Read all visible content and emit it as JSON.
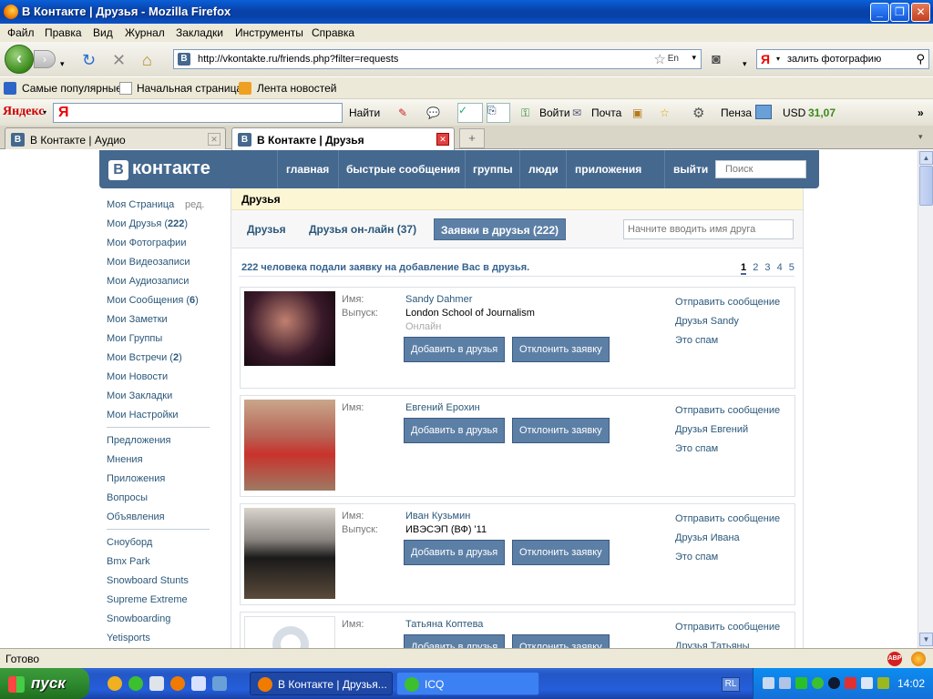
{
  "window": {
    "title": "В Контакте | Друзья - Mozilla Firefox"
  },
  "menubar": [
    "Файл",
    "Правка",
    "Вид",
    "Журнал",
    "Закладки",
    "Инструменты",
    "Справка"
  ],
  "navbar": {
    "url": "http://vkontakte.ru/friends.php?filter=requests",
    "url_lang": "En",
    "search_value": "залить фотографию"
  },
  "bookmarks": [
    "Самые популярные",
    "Начальная страница",
    "Лента новостей"
  ],
  "yandex_bar": {
    "logo": "Яндекс",
    "find": "Найти",
    "login": "Войти",
    "mail": "Почта",
    "city": "Пенза",
    "usd_label": "USD",
    "usd_value": "31,07"
  },
  "tabs": [
    {
      "label": "В Контакте | Аудио",
      "active": false
    },
    {
      "label": "В Контакте | Друзья",
      "active": true
    }
  ],
  "vk": {
    "logo_text": "контакте",
    "nav": [
      "главная",
      "быстрые сообщения",
      "группы",
      "люди",
      "приложения",
      "выйти"
    ],
    "search_placeholder": "Поиск"
  },
  "left_menu": {
    "edit": "ред.",
    "group1": [
      {
        "label": "Моя Страница",
        "count": ""
      },
      {
        "label": "Мои Друзья",
        "count": "222"
      },
      {
        "label": "Мои Фотографии",
        "count": ""
      },
      {
        "label": "Мои Видеозаписи",
        "count": ""
      },
      {
        "label": "Мои Аудиозаписи",
        "count": ""
      },
      {
        "label": "Мои Сообщения",
        "count": "6"
      },
      {
        "label": "Мои Заметки",
        "count": ""
      },
      {
        "label": "Мои Группы",
        "count": ""
      },
      {
        "label": "Мои Встречи",
        "count": "2"
      },
      {
        "label": "Мои Новости",
        "count": ""
      },
      {
        "label": "Мои Закладки",
        "count": ""
      },
      {
        "label": "Мои Настройки",
        "count": ""
      }
    ],
    "group2": [
      "Предложения",
      "Мнения",
      "Приложения",
      "Вопросы",
      "Объявления"
    ],
    "group3": [
      "Сноуборд",
      "Bmx Park",
      "Snowboard Stunts",
      "Supreme Extreme",
      "Snowboarding",
      "Yetisports"
    ]
  },
  "main": {
    "header": "Друзья",
    "subtabs": [
      "Друзья",
      "Друзья он-лайн (37)",
      "Заявки в друзья (222)"
    ],
    "friend_search_placeholder": "Начните вводить имя друга",
    "summary": "222 человека подали заявку на добавление Вас в друзья.",
    "pages": [
      "1",
      "2",
      "3",
      "4",
      "5"
    ],
    "labels": {
      "name": "Имя:",
      "graduation": "Выпуск:"
    },
    "buttons": {
      "add": "Добавить в друзья",
      "decline": "Отклонить заявку"
    },
    "requests": [
      {
        "name": "Sandy Dahmer",
        "graduation": "London School of Journalism",
        "online": "Онлайн",
        "links": [
          "Отправить сообщение",
          "Друзья Sandy",
          "Это спам"
        ]
      },
      {
        "name": "Евгений Ерохин",
        "graduation": "",
        "online": "",
        "links": [
          "Отправить сообщение",
          "Друзья Евгений",
          "Это спам"
        ]
      },
      {
        "name": "Иван Кузьмин",
        "graduation": "ИВЭСЭП (ВФ) '11",
        "online": "",
        "links": [
          "Отправить сообщение",
          "Друзья Ивана",
          "Это спам"
        ]
      },
      {
        "name": "Татьяна Коптева",
        "graduation": "",
        "online": "",
        "links": [
          "Отправить сообщение",
          "Друзья Татьяны",
          ""
        ]
      }
    ]
  },
  "statusbar": {
    "text": "Готово",
    "abp": "ABP"
  },
  "taskbar": {
    "start": "пуск",
    "tasks": [
      {
        "label": "В Контакте | Друзья...",
        "active": true
      },
      {
        "label": "ICQ",
        "active": false
      }
    ],
    "lang": "RL",
    "clock": "14:02"
  }
}
